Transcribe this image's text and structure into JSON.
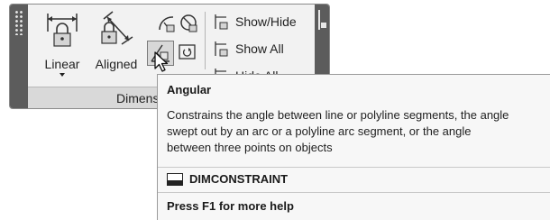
{
  "panel": {
    "title": "Dimens",
    "buttons": {
      "linear": "Linear",
      "aligned": "Aligned"
    },
    "rows": {
      "show_hide": "Show/Hide",
      "show_all": "Show All",
      "hide_all": "Hide All"
    },
    "icons": {
      "linear": "linear-constraint-icon",
      "aligned": "aligned-constraint-icon",
      "radius": "radius-constraint-icon",
      "diameter": "diameter-constraint-icon",
      "angular": "angular-constraint-icon",
      "convert": "convert-icon",
      "show_hide": "show-hide-icon",
      "show_all": "show-all-icon",
      "hide_all": "hide-all-icon"
    }
  },
  "tooltip": {
    "title": "Angular",
    "description": [
      "Constrains the angle between line or polyline segments, the angle",
      "swept out by an arc or a polyline arc segment, or the angle",
      "between three points on objects"
    ],
    "command": "DIMCONSTRAINT",
    "help": "Press F1 for more help"
  }
}
